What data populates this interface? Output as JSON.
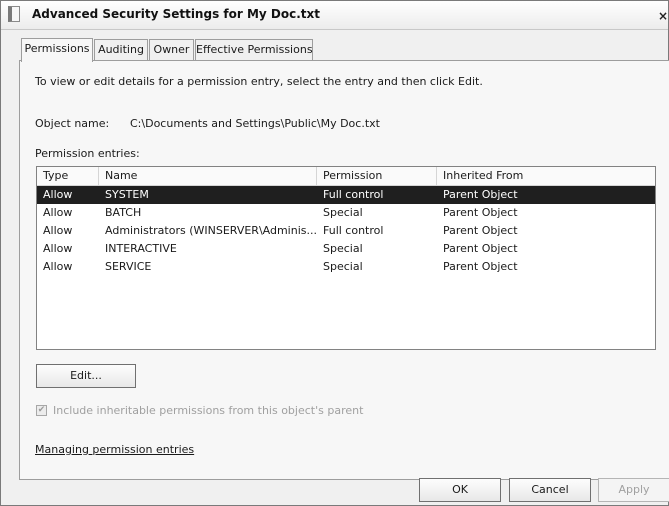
{
  "window": {
    "title": "Advanced Security Settings for My Doc.txt",
    "close_glyph": "×"
  },
  "tabs": [
    {
      "label": "Permissions",
      "active": true
    },
    {
      "label": "Auditing"
    },
    {
      "label": "Owner"
    },
    {
      "label": "Effective Permissions"
    }
  ],
  "permissions": {
    "instruction": "To view or edit details for a permission entry, select the entry and then click Edit.",
    "object_label": "Object name:",
    "object_value": "C:\\Documents and Settings\\Public\\My Doc.txt",
    "entries_label": "Permission entries:",
    "columns": [
      "Type",
      "Name",
      "Permission",
      "Inherited From"
    ],
    "rows": [
      {
        "type": "Allow",
        "name": "SYSTEM",
        "permission": "Full control",
        "inherited": "Parent Object",
        "selected": true
      },
      {
        "type": "Allow",
        "name": "BATCH",
        "permission": "Special",
        "inherited": "Parent Object"
      },
      {
        "type": "Allow",
        "name": "Administrators (WINSERVER\\Adminis...",
        "permission": "Full control",
        "inherited": "Parent Object"
      },
      {
        "type": "Allow",
        "name": "INTERACTIVE",
        "permission": "Special",
        "inherited": "Parent Object"
      },
      {
        "type": "Allow",
        "name": "SERVICE",
        "permission": "Special",
        "inherited": "Parent Object"
      }
    ],
    "edit_button": "Edit...",
    "inherit_checkbox": {
      "label": "Include inheritable permissions from this object's parent",
      "checked": true,
      "disabled": true
    },
    "link": "Managing permission entries"
  },
  "footer": {
    "ok": "OK",
    "cancel": "Cancel",
    "apply": "Apply"
  }
}
